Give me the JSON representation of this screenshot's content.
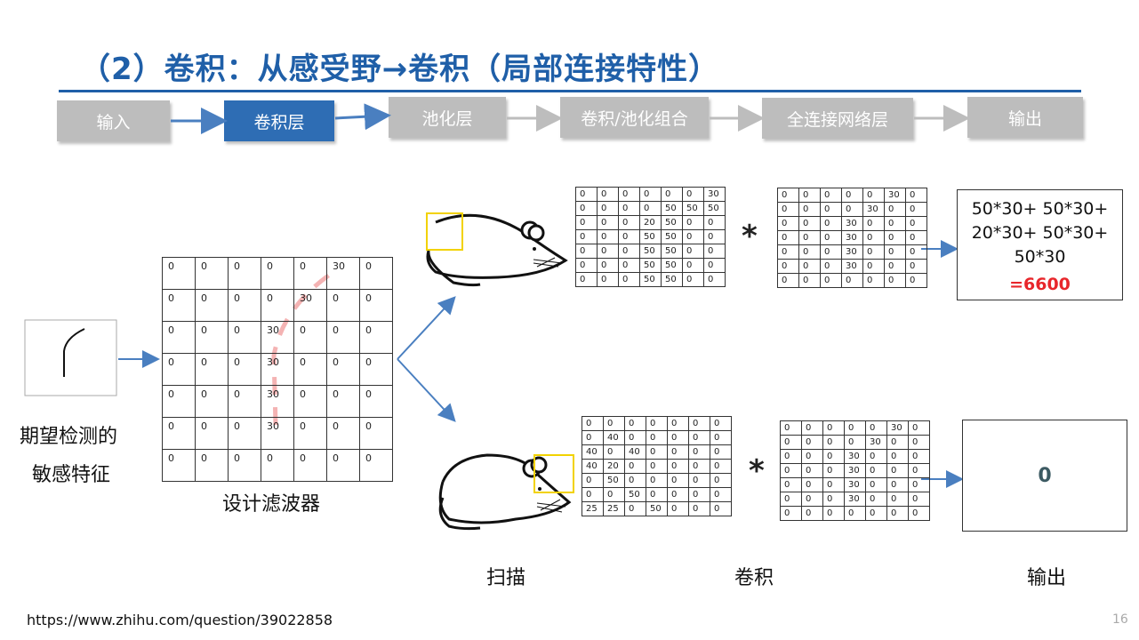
{
  "title": "（2）卷积：从感受野→卷积（局部连接特性）",
  "flow": [
    {
      "label": "输入",
      "active": false
    },
    {
      "label": "卷积层",
      "active": true
    },
    {
      "label": "池化层",
      "active": false
    },
    {
      "label": "卷积/池化组合",
      "active": false
    },
    {
      "label": "全连接网络层",
      "active": false
    },
    {
      "label": "输出",
      "active": false
    }
  ],
  "feature_label_1": "期望检测的",
  "feature_label_2": "敏感特征",
  "filter_label": "设计滤波器",
  "filter_grid": [
    [
      "0",
      "0",
      "0",
      "0",
      "0",
      "30",
      "0"
    ],
    [
      "0",
      "0",
      "0",
      "0",
      "30",
      "0",
      "0"
    ],
    [
      "0",
      "0",
      "0",
      "30",
      "0",
      "0",
      "0"
    ],
    [
      "0",
      "0",
      "0",
      "30",
      "0",
      "0",
      "0"
    ],
    [
      "0",
      "0",
      "0",
      "30",
      "0",
      "0",
      "0"
    ],
    [
      "0",
      "0",
      "0",
      "30",
      "0",
      "0",
      "0"
    ],
    [
      "0",
      "0",
      "0",
      "0",
      "0",
      "0",
      "0"
    ]
  ],
  "region_top": [
    [
      "0",
      "0",
      "0",
      "0",
      "0",
      "0",
      "30"
    ],
    [
      "0",
      "0",
      "0",
      "0",
      "50",
      "50",
      "50"
    ],
    [
      "0",
      "0",
      "0",
      "20",
      "50",
      "0",
      "0"
    ],
    [
      "0",
      "0",
      "0",
      "50",
      "50",
      "0",
      "0"
    ],
    [
      "0",
      "0",
      "0",
      "50",
      "50",
      "0",
      "0"
    ],
    [
      "0",
      "0",
      "0",
      "50",
      "50",
      "0",
      "0"
    ],
    [
      "0",
      "0",
      "0",
      "50",
      "50",
      "0",
      "0"
    ]
  ],
  "filter_top": [
    [
      "0",
      "0",
      "0",
      "0",
      "0",
      "30",
      "0"
    ],
    [
      "0",
      "0",
      "0",
      "0",
      "30",
      "0",
      "0"
    ],
    [
      "0",
      "0",
      "0",
      "30",
      "0",
      "0",
      "0"
    ],
    [
      "0",
      "0",
      "0",
      "30",
      "0",
      "0",
      "0"
    ],
    [
      "0",
      "0",
      "0",
      "30",
      "0",
      "0",
      "0"
    ],
    [
      "0",
      "0",
      "0",
      "30",
      "0",
      "0",
      "0"
    ],
    [
      "0",
      "0",
      "0",
      "0",
      "0",
      "0",
      "0"
    ]
  ],
  "region_bottom": [
    [
      "0",
      "0",
      "0",
      "0",
      "0",
      "0",
      "0"
    ],
    [
      "0",
      "40",
      "0",
      "0",
      "0",
      "0",
      "0"
    ],
    [
      "40",
      "0",
      "40",
      "0",
      "0",
      "0",
      "0"
    ],
    [
      "40",
      "20",
      "0",
      "0",
      "0",
      "0",
      "0"
    ],
    [
      "0",
      "50",
      "0",
      "0",
      "0",
      "0",
      "0"
    ],
    [
      "0",
      "0",
      "50",
      "0",
      "0",
      "0",
      "0"
    ],
    [
      "25",
      "25",
      "0",
      "50",
      "0",
      "0",
      "0"
    ]
  ],
  "filter_bottom": [
    [
      "0",
      "0",
      "0",
      "0",
      "0",
      "30",
      "0"
    ],
    [
      "0",
      "0",
      "0",
      "0",
      "30",
      "0",
      "0"
    ],
    [
      "0",
      "0",
      "0",
      "30",
      "0",
      "0",
      "0"
    ],
    [
      "0",
      "0",
      "0",
      "30",
      "0",
      "0",
      "0"
    ],
    [
      "0",
      "0",
      "0",
      "30",
      "0",
      "0",
      "0"
    ],
    [
      "0",
      "0",
      "0",
      "30",
      "0",
      "0",
      "0"
    ],
    [
      "0",
      "0",
      "0",
      "0",
      "0",
      "0",
      "0"
    ]
  ],
  "conv_symbol": "*",
  "result_top_lines": [
    "50*30+ 50*30+",
    "20*30+ 50*30+",
    "50*30"
  ],
  "result_top_value": "=6600",
  "result_bottom_value": "0",
  "bottom_labels": {
    "scan": "扫描",
    "conv": "卷积",
    "output": "输出"
  },
  "footer_url": "https://www.zhihu.com/question/39022858",
  "page_number": "16",
  "colors": {
    "title": "#1f5fa8",
    "active_box": "#2e6db4",
    "inactive_box": "#bdbdbd",
    "arrow": "#4a7fc0",
    "highlight": "#e8262b",
    "receptive_field": "#f2d200"
  }
}
